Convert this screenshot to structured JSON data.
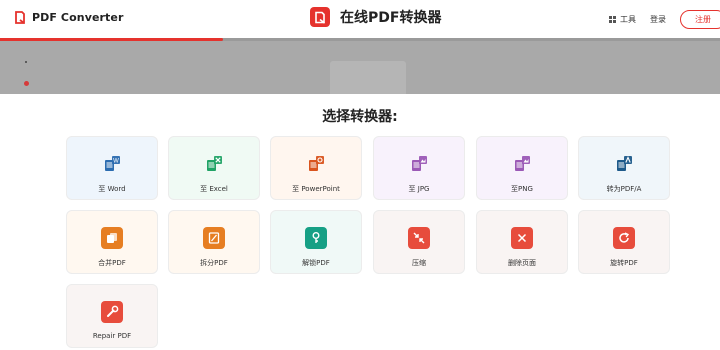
{
  "header": {
    "brand": "PDF Converter",
    "center_title": "在线PDF转换器",
    "tools_label": "工具",
    "login_label": "登录",
    "register_label": "注册"
  },
  "progress": {
    "value_percent": 31
  },
  "section_title": "选择转换器:",
  "converters": [
    {
      "label": "至 Word",
      "icon": "pdf-to-word-icon",
      "color": "#2b6cb0",
      "bg": "#eef5fc"
    },
    {
      "label": "至 Excel",
      "icon": "pdf-to-excel-icon",
      "color": "#21a366",
      "bg": "#f0faf4"
    },
    {
      "label": "至 PowerPoint",
      "icon": "pdf-to-powerpoint-icon",
      "color": "#d9541e",
      "bg": "#fff6ef"
    },
    {
      "label": "至 JPG",
      "icon": "pdf-to-jpg-icon",
      "color": "#9b59b6",
      "bg": "#f8f2fc"
    },
    {
      "label": "至PNG",
      "icon": "pdf-to-png-icon",
      "color": "#9b59b6",
      "bg": "#f8f2fc"
    },
    {
      "label": "转为PDF/A",
      "icon": "pdf-to-pdfa-icon",
      "color": "#1e5a8a",
      "bg": "#f0f6fa"
    },
    {
      "label": "合并PDF",
      "icon": "merge-pdf-icon",
      "color": "#e67e22",
      "bg": "#fff8f0"
    },
    {
      "label": "拆分PDF",
      "icon": "split-pdf-icon",
      "color": "#e67e22",
      "bg": "#fff8f0"
    },
    {
      "label": "解锁PDF",
      "icon": "unlock-pdf-icon",
      "color": "#16a085",
      "bg": "#f0f9f7"
    },
    {
      "label": "压缩",
      "icon": "compress-pdf-icon",
      "color": "#e74c3c",
      "bg": "#f9f4f3"
    },
    {
      "label": "删除页面",
      "icon": "delete-pages-icon",
      "color": "#e74c3c",
      "bg": "#f9f4f3"
    },
    {
      "label": "旋转PDF",
      "icon": "rotate-pdf-icon",
      "color": "#e74c3c",
      "bg": "#f9f4f3"
    },
    {
      "label": "Repair PDF",
      "icon": "repair-pdf-icon",
      "color": "#e74c3c",
      "bg": "#f9f4f3"
    }
  ]
}
